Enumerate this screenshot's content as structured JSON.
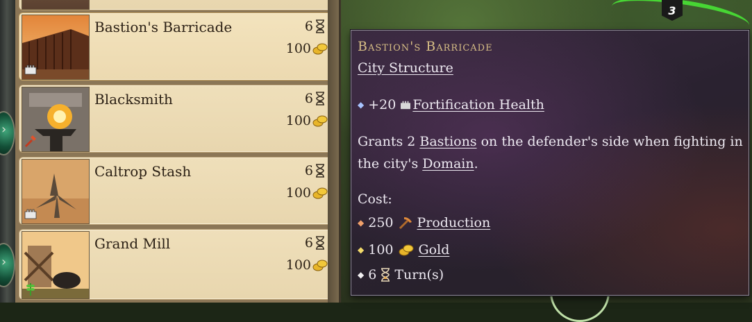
{
  "list": {
    "items": [
      {
        "name": "Bastion's Barricade",
        "turns": "6",
        "cost": "100",
        "corner_icon": "fortification-icon"
      },
      {
        "name": "Blacksmith",
        "turns": "6",
        "cost": "100",
        "corner_icon": "hammer-icon"
      },
      {
        "name": "Caltrop Stash",
        "turns": "6",
        "cost": "100",
        "corner_icon": "fortification-icon"
      },
      {
        "name": "Grand Mill",
        "turns": "6",
        "cost": "100",
        "corner_icon": "wheat-icon"
      }
    ]
  },
  "map": {
    "badge_number": "3"
  },
  "tooltip": {
    "title": "Bastion's Barricade",
    "subtitle": "City Structure",
    "effect_value": "+20",
    "effect_label": "Fortification Health",
    "desc_pre": "Grants 2 ",
    "desc_link1": "Bastions",
    "desc_mid": " on the defender's side when fighting in the city's ",
    "desc_link2": "Domain",
    "desc_end": ".",
    "cost_heading": "Cost:",
    "costs": [
      {
        "value": "250",
        "label": "Production",
        "icon": "hammer-pick-icon",
        "bullet_color": "#f0a06a"
      },
      {
        "value": "100",
        "label": "Gold",
        "icon": "gold-coins-icon",
        "bullet_color": "#f2da6a"
      },
      {
        "value": "6",
        "label": "Turn(s)",
        "icon": "hourglass-icon",
        "bullet_color": "#f2f0f2"
      }
    ]
  },
  "colors": {
    "parchment": "#ecd9b0",
    "tooltip_bg": "#2a2230",
    "title_gold": "#d8bf86",
    "map_road_green": "#47d634"
  }
}
